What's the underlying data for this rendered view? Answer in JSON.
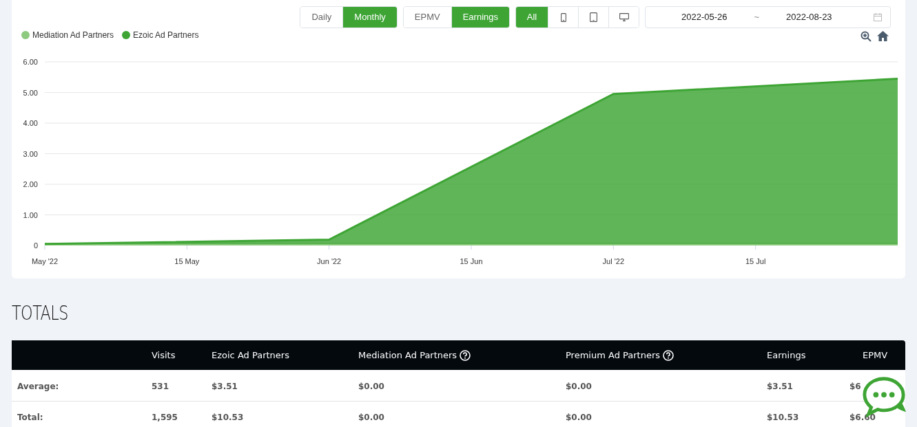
{
  "toolbar": {
    "period": [
      {
        "label": "Daily",
        "selected": false
      },
      {
        "label": "Monthly",
        "selected": true
      }
    ],
    "metric": [
      {
        "label": "EPMV",
        "selected": false
      },
      {
        "label": "Earnings",
        "selected": true
      }
    ],
    "device": [
      {
        "kind": "all",
        "label": "All",
        "selected": true
      },
      {
        "kind": "phone",
        "selected": false
      },
      {
        "kind": "tablet",
        "selected": false
      },
      {
        "kind": "desktop",
        "selected": false
      }
    ],
    "date_range": {
      "start": "2022-05-26",
      "separator": "~",
      "end": "2022-08-23"
    }
  },
  "chart": {
    "chart_data": {
      "type": "area",
      "stacked": true,
      "grid": true,
      "categories": [
        "May '22",
        "15 May",
        "Jun '22",
        "15 Jun",
        "Jul '22",
        "15 Jul",
        null
      ],
      "ylim": [
        0,
        6
      ],
      "yticks": [
        {
          "value": 0,
          "label": "0"
        },
        {
          "value": 1,
          "label": "1.00"
        },
        {
          "value": 2,
          "label": "2.00"
        },
        {
          "value": 3,
          "label": "3.00"
        },
        {
          "value": 4,
          "label": "4.00"
        },
        {
          "value": 5,
          "label": "5.00"
        },
        {
          "value": 6,
          "label": "6.00"
        }
      ],
      "series": [
        {
          "name": "Mediation Ad Partners",
          "color": "#8dc97e",
          "values": [
            0.05,
            null,
            0.05,
            null,
            0.05,
            null,
            0.05
          ]
        },
        {
          "name": "Ezoic Ad Partners",
          "color": "#3ea535",
          "values": [
            0,
            null,
            0.14,
            null,
            4.9,
            null,
            5.4
          ]
        }
      ]
    }
  },
  "totals": {
    "title": "TOTALS",
    "columns": [
      {
        "help": false
      },
      {
        "label": "Visits",
        "help": false
      },
      {
        "label": "Ezoic Ad Partners",
        "help": false
      },
      {
        "label": "Mediation Ad Partners",
        "help": true
      },
      {
        "label": "Premium Ad Partners",
        "help": true
      },
      {
        "label": "Earnings",
        "help": false
      },
      {
        "label": "EPMV",
        "help": false
      }
    ],
    "rows": [
      {
        "cells": [
          "Average:",
          "531",
          "$3.51",
          "$0.00",
          "$0.00",
          "$3.51",
          "$6"
        ]
      },
      {
        "cells": [
          "Total:",
          "1,595",
          "$10.53",
          "$0.00",
          "$0.00",
          "$10.53",
          "$6.60"
        ]
      }
    ]
  }
}
